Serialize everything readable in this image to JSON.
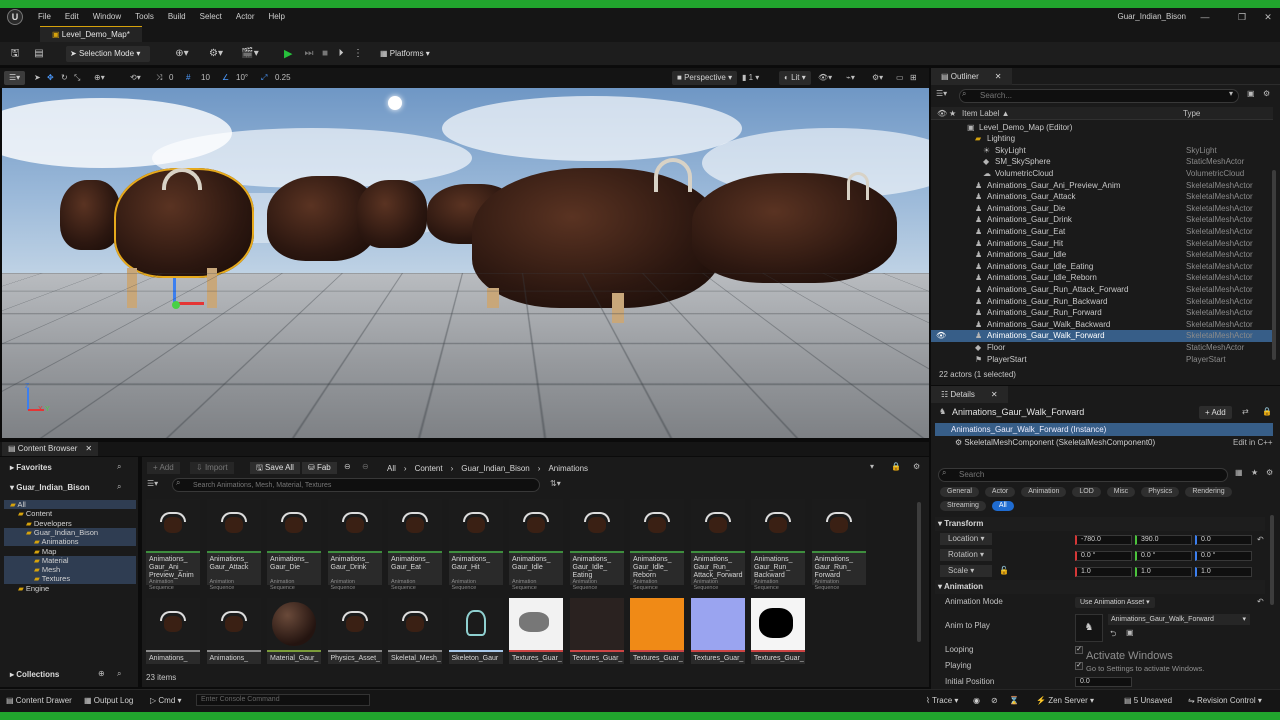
{
  "window": {
    "title": "Guar_Indian_Bison",
    "menu": [
      "File",
      "Edit",
      "Window",
      "Tools",
      "Build",
      "Select",
      "Actor",
      "Help"
    ],
    "document_tab": "Level_Demo_Map*"
  },
  "toolbar": {
    "selection_mode": "Selection Mode",
    "platforms": "Platforms"
  },
  "viewport": {
    "snap_rotation_val": "0",
    "grid_snap": "10",
    "rotation_snap": "10°",
    "scale_snap": "0.25",
    "perspective": "Perspective",
    "fov": "1",
    "lit": "Lit",
    "axis_z": "Z",
    "axis_x": "X",
    "axis_y": "Y"
  },
  "outliner": {
    "tab": "Outliner",
    "search_placeholder": "Search...",
    "col_label": "Item Label ▲",
    "col_type": "Type",
    "rows": [
      {
        "label": "Level_Demo_Map (Editor)",
        "type": "",
        "indent": 1,
        "icon": "level-icon"
      },
      {
        "label": "Lighting",
        "type": "",
        "indent": 2,
        "icon": "folder-icon"
      },
      {
        "label": "SkyLight",
        "type": "SkyLight",
        "indent": 3,
        "icon": "light-icon"
      },
      {
        "label": "SM_SkySphere",
        "type": "StaticMeshActor",
        "indent": 3,
        "icon": "mesh-icon"
      },
      {
        "label": "VolumetricCloud",
        "type": "VolumetricCloud",
        "indent": 3,
        "icon": "cloud-icon"
      },
      {
        "label": "Animations_Gaur_Ani_Preview_Anim",
        "type": "SkeletalMeshActor",
        "indent": 2,
        "icon": "skeleton-icon"
      },
      {
        "label": "Animations_Gaur_Attack",
        "type": "SkeletalMeshActor",
        "indent": 2,
        "icon": "skeleton-icon"
      },
      {
        "label": "Animations_Gaur_Die",
        "type": "SkeletalMeshActor",
        "indent": 2,
        "icon": "skeleton-icon"
      },
      {
        "label": "Animations_Gaur_Drink",
        "type": "SkeletalMeshActor",
        "indent": 2,
        "icon": "skeleton-icon"
      },
      {
        "label": "Animations_Gaur_Eat",
        "type": "SkeletalMeshActor",
        "indent": 2,
        "icon": "skeleton-icon"
      },
      {
        "label": "Animations_Gaur_Hit",
        "type": "SkeletalMeshActor",
        "indent": 2,
        "icon": "skeleton-icon"
      },
      {
        "label": "Animations_Gaur_Idle",
        "type": "SkeletalMeshActor",
        "indent": 2,
        "icon": "skeleton-icon"
      },
      {
        "label": "Animations_Gaur_Idle_Eating",
        "type": "SkeletalMeshActor",
        "indent": 2,
        "icon": "skeleton-icon"
      },
      {
        "label": "Animations_Gaur_Idle_Reborn",
        "type": "SkeletalMeshActor",
        "indent": 2,
        "icon": "skeleton-icon"
      },
      {
        "label": "Animations_Gaur_Run_Attack_Forward",
        "type": "SkeletalMeshActor",
        "indent": 2,
        "icon": "skeleton-icon"
      },
      {
        "label": "Animations_Gaur_Run_Backward",
        "type": "SkeletalMeshActor",
        "indent": 2,
        "icon": "skeleton-icon"
      },
      {
        "label": "Animations_Gaur_Run_Forward",
        "type": "SkeletalMeshActor",
        "indent": 2,
        "icon": "skeleton-icon"
      },
      {
        "label": "Animations_Gaur_Walk_Backward",
        "type": "SkeletalMeshActor",
        "indent": 2,
        "icon": "skeleton-icon"
      },
      {
        "label": "Animations_Gaur_Walk_Forward",
        "type": "SkeletalMeshActor",
        "indent": 2,
        "icon": "skeleton-icon",
        "selected": true
      },
      {
        "label": "Floor",
        "type": "StaticMeshActor",
        "indent": 2,
        "icon": "mesh-icon"
      },
      {
        "label": "PlayerStart",
        "type": "PlayerStart",
        "indent": 2,
        "icon": "flag-icon"
      }
    ],
    "footer": "22 actors (1 selected)"
  },
  "details": {
    "tab": "Details",
    "actor_name": "Animations_Gaur_Walk_Forward",
    "add_label": "+ Add",
    "instance": "Animations_Gaur_Walk_Forward (Instance)",
    "component": "SkeletalMeshComponent (SkeletalMeshComponent0)",
    "edit_cpp": "Edit in C++",
    "search_placeholder": "Search",
    "filters_row1": [
      "General",
      "Actor",
      "Animation",
      "LOD",
      "Misc",
      "Physics",
      "Rendering"
    ],
    "filters_row2": [
      "Streaming",
      "All"
    ],
    "transform_header": "Transform",
    "location_label": "Location",
    "location": [
      "-780.0",
      "390.0",
      "0.0"
    ],
    "rotation_label": "Rotation",
    "rotation": [
      "0.0 °",
      "0.0 °",
      "0.0 °"
    ],
    "scale_label": "Scale",
    "scale": [
      "1.0",
      "1.0",
      "1.0"
    ],
    "animation_header": "Animation",
    "anim_mode_label": "Animation Mode",
    "anim_mode_value": "Use Animation Asset",
    "anim_to_play_label": "Anim to Play",
    "anim_to_play_value": "Animations_Gaur_Walk_Forward",
    "looping_label": "Looping",
    "playing_label": "Playing",
    "initial_position_label": "Initial Position",
    "initial_position_value": "0.0"
  },
  "watermark": {
    "line1": "Activate Windows",
    "line2": "Go to Settings to activate Windows."
  },
  "content_browser": {
    "tab": "Content Browser",
    "favorites": "Favorites",
    "project": "Guar_Indian_Bison",
    "add": "+ Add",
    "import": "Import",
    "save_all": "Save All",
    "fab": "Fab",
    "breadcrumbs": [
      "All",
      "Content",
      "Guar_Indian_Bison",
      "Animations"
    ],
    "search_placeholder": "Search Animations, Mesh, Material, Textures",
    "tree": [
      {
        "label": "All",
        "indent": 0,
        "sel": true
      },
      {
        "label": "Content",
        "indent": 1,
        "sel": false
      },
      {
        "label": "Developers",
        "indent": 2,
        "sel": false
      },
      {
        "label": "Guar_Indian_Bison",
        "indent": 2,
        "sel": true
      },
      {
        "label": "Animations",
        "indent": 3,
        "sel": true
      },
      {
        "label": "Map",
        "indent": 3,
        "sel": false
      },
      {
        "label": "Material",
        "indent": 3,
        "sel": true
      },
      {
        "label": "Mesh",
        "indent": 3,
        "sel": true
      },
      {
        "label": "Textures",
        "indent": 3,
        "sel": true
      },
      {
        "label": "Engine",
        "indent": 1,
        "sel": false
      }
    ],
    "collections": "Collections",
    "item_count": "23 items",
    "assets_row1": [
      {
        "name": "Animations_ Gaur_Ani_ Preview_Anim",
        "type": "Animation Sequence"
      },
      {
        "name": "Animations_ Gaur_Attack",
        "type": "Animation Sequence"
      },
      {
        "name": "Animations_ Gaur_Die",
        "type": "Animation Sequence"
      },
      {
        "name": "Animations_ Gaur_Drink",
        "type": "Animation Sequence"
      },
      {
        "name": "Animations_ Gaur_Eat",
        "type": "Animation Sequence"
      },
      {
        "name": "Animations_ Gaur_Hit",
        "type": "Animation Sequence"
      },
      {
        "name": "Animations_ Gaur_Idle",
        "type": "Animation Sequence"
      },
      {
        "name": "Animations_ Gaur_Idle_ Eating",
        "type": "Animation Sequence"
      },
      {
        "name": "Animations_ Gaur_Idle_ Reborn",
        "type": "Animation Sequence"
      },
      {
        "name": "Animations_ Gaur_Run_ Attack_Forward",
        "type": "Animation Sequence"
      },
      {
        "name": "Animations_ Gaur_Run_ Backward",
        "type": "Animation Sequence"
      },
      {
        "name": "Animations_ Gaur_Run_ Forward",
        "type": "Animation Sequence"
      }
    ],
    "assets_row2": [
      {
        "name": "Animations_",
        "kind": "anim"
      },
      {
        "name": "Animations_",
        "kind": "anim"
      },
      {
        "name": "Material_Gaur_",
        "kind": "sphere"
      },
      {
        "name": "Physics_Asset_",
        "kind": "anim"
      },
      {
        "name": "Skeletal_Mesh_",
        "kind": "anim"
      },
      {
        "name": "Skeleton_Gaur",
        "kind": "skeleton"
      },
      {
        "name": "Textures_Guar_",
        "kind": "tex-white"
      },
      {
        "name": "Textures_Guar_",
        "kind": "tex-dark"
      },
      {
        "name": "Textures_Guar_",
        "kind": "tex-orange"
      },
      {
        "name": "Textures_Guar_",
        "kind": "tex-normal"
      },
      {
        "name": "Textures_Guar_",
        "kind": "tex-mask"
      }
    ]
  },
  "statusbar": {
    "content_drawer": "Content Drawer",
    "output_log": "Output Log",
    "cmd": "Cmd",
    "console_placeholder": "Enter Console Command",
    "trace": "Trace",
    "zen_server": "Zen Server",
    "unsaved": "5 Unsaved",
    "revision_control": "Revision Control"
  },
  "colors": {
    "accent_green": "#21a52d",
    "selection_blue": "#375e88",
    "filter_active": "#1f6cd1",
    "play_green": "#27c13c"
  }
}
